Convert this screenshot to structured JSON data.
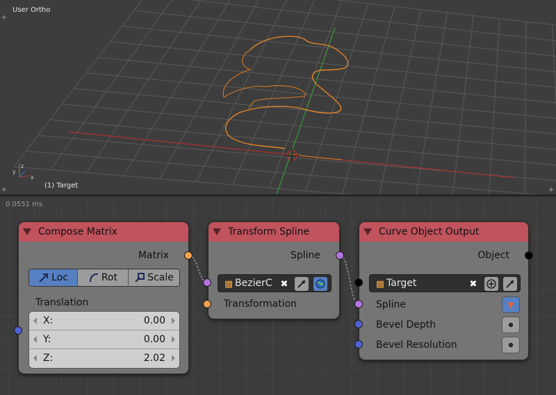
{
  "viewport": {
    "view_name": "User Ortho",
    "object_label": "(1) Target"
  },
  "node_editor": {
    "timing": "0.0551 ms"
  },
  "colors": {
    "node_header": "#c0535c",
    "node_body": "#757575",
    "socket_matrix": "#f1a24f",
    "socket_spline": "#b574e2",
    "socket_float": "#5062d3",
    "socket_object": "#000000",
    "toggle_active": "#5680c2",
    "curve_selected": "#f08a24"
  },
  "compose_matrix": {
    "title": "Compose Matrix",
    "output_matrix": "Matrix",
    "modes": [
      {
        "label": "Loc",
        "icon": "arrow-icon",
        "active": true
      },
      {
        "label": "Rot",
        "icon": "arc-icon",
        "active": false
      },
      {
        "label": "Scale",
        "icon": "scale-icon",
        "active": false
      }
    ],
    "section_label": "Translation",
    "vector": [
      {
        "label": "X:",
        "value": "0.00"
      },
      {
        "label": "Y:",
        "value": "0.00"
      },
      {
        "label": "Z:",
        "value": "2.02"
      }
    ]
  },
  "transform_spline": {
    "title": "Transform Spline",
    "output_spline": "Spline",
    "input_object": "BezierC",
    "input_transformation": "Transformation"
  },
  "curve_object_output": {
    "title": "Curve Object Output",
    "output_object": "Object",
    "target_object": "Target",
    "inputs": [
      {
        "label": "Spline"
      },
      {
        "label": "Bevel Depth"
      },
      {
        "label": "Bevel Resolution"
      }
    ]
  }
}
